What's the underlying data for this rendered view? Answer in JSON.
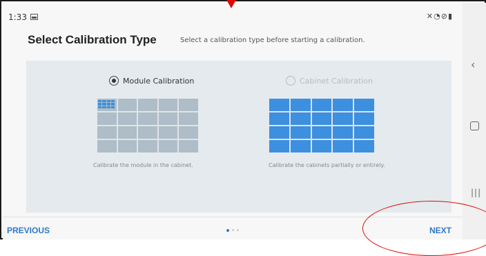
{
  "status_bar": {
    "time": "1:33",
    "icons": [
      "gallery-icon",
      "mute-icon",
      "wifi-icon",
      "dnd-icon",
      "battery-icon"
    ]
  },
  "header": {
    "title": "Select Calibration Type",
    "subtitle": "Select a calibration type before starting a calibration."
  },
  "options": {
    "module": {
      "label": "Module Calibration",
      "selected": true,
      "description": "Calibrate the module in the cabinet."
    },
    "cabinet": {
      "label": "Cabinet Calibration",
      "selected": false,
      "description": "Calibrate the cabinets partially or entirely."
    }
  },
  "footer": {
    "previous_label": "PREVIOUS",
    "next_label": "NEXT",
    "page_count": 3,
    "active_page": 1
  },
  "colors": {
    "accent": "#2f79c9",
    "cabinet_blue": "#3d8fe0",
    "annotation_red": "#e10600"
  },
  "nav_bar": [
    "back-icon",
    "home-icon",
    "recent-apps-icon"
  ]
}
